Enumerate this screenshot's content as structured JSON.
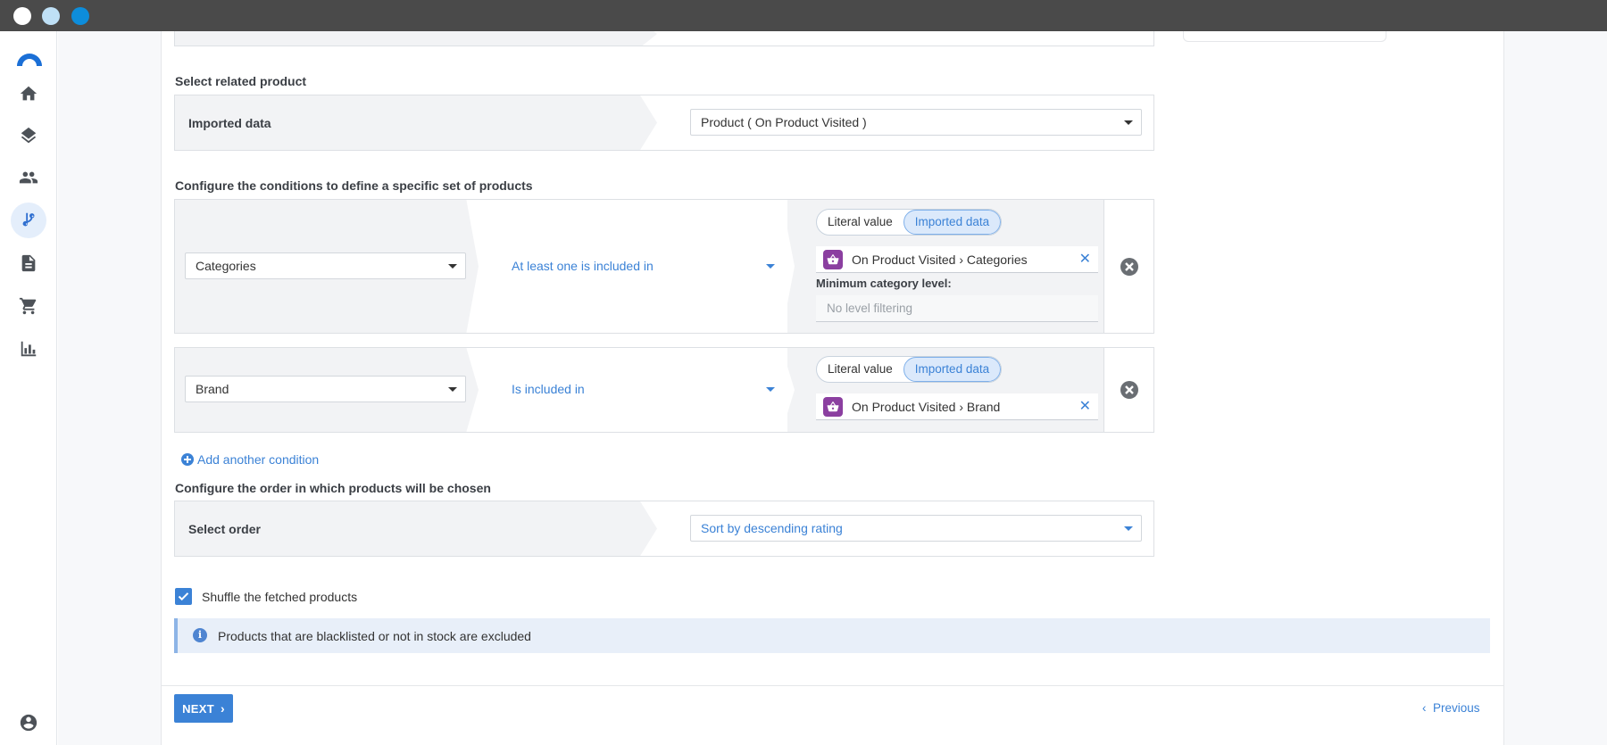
{
  "window": {
    "title_dots": [
      "close",
      "minimize",
      "maximize"
    ]
  },
  "sidebar": {
    "items": [
      {
        "name": "home",
        "icon": "home-icon"
      },
      {
        "name": "layers",
        "icon": "layers-icon"
      },
      {
        "name": "people",
        "icon": "people-icon"
      },
      {
        "name": "journeys",
        "icon": "branch-icon",
        "active": true
      },
      {
        "name": "documents",
        "icon": "document-icon"
      },
      {
        "name": "cart",
        "icon": "cart-icon"
      },
      {
        "name": "analytics",
        "icon": "bar-chart-icon"
      }
    ],
    "bottom_icon": "account-icon"
  },
  "related_product": {
    "section_title": "Select related product",
    "label": "Imported data",
    "value": "Product ( On Product Visited )"
  },
  "conditions": {
    "section_title": "Configure the conditions to define a specific set of products",
    "items": [
      {
        "field": "Categories",
        "operator": "At least one is included in",
        "toggle": {
          "literal": "Literal value",
          "imported": "Imported data",
          "selected": "imported"
        },
        "chip": "On Product Visited › Categories",
        "min_level_label": "Minimum category level:",
        "min_level_placeholder": "No level filtering"
      },
      {
        "field": "Brand",
        "operator": "Is included in",
        "toggle": {
          "literal": "Literal value",
          "imported": "Imported data",
          "selected": "imported"
        },
        "chip": "On Product Visited › Brand"
      }
    ],
    "add_label": "Add another condition"
  },
  "order": {
    "section_title": "Configure the order in which products will be chosen",
    "label": "Select order",
    "value": "Sort by descending rating"
  },
  "shuffle": {
    "label": "Shuffle the fetched products",
    "checked": true
  },
  "info": {
    "text": "Products that are blacklisted or not in stock are excluded"
  },
  "footer": {
    "next_label": "NEXT",
    "previous_label": "Previous"
  },
  "colors": {
    "accent": "#3b82d6",
    "bag": "#8b3fa0",
    "titlebar": "#4a4a4a"
  }
}
